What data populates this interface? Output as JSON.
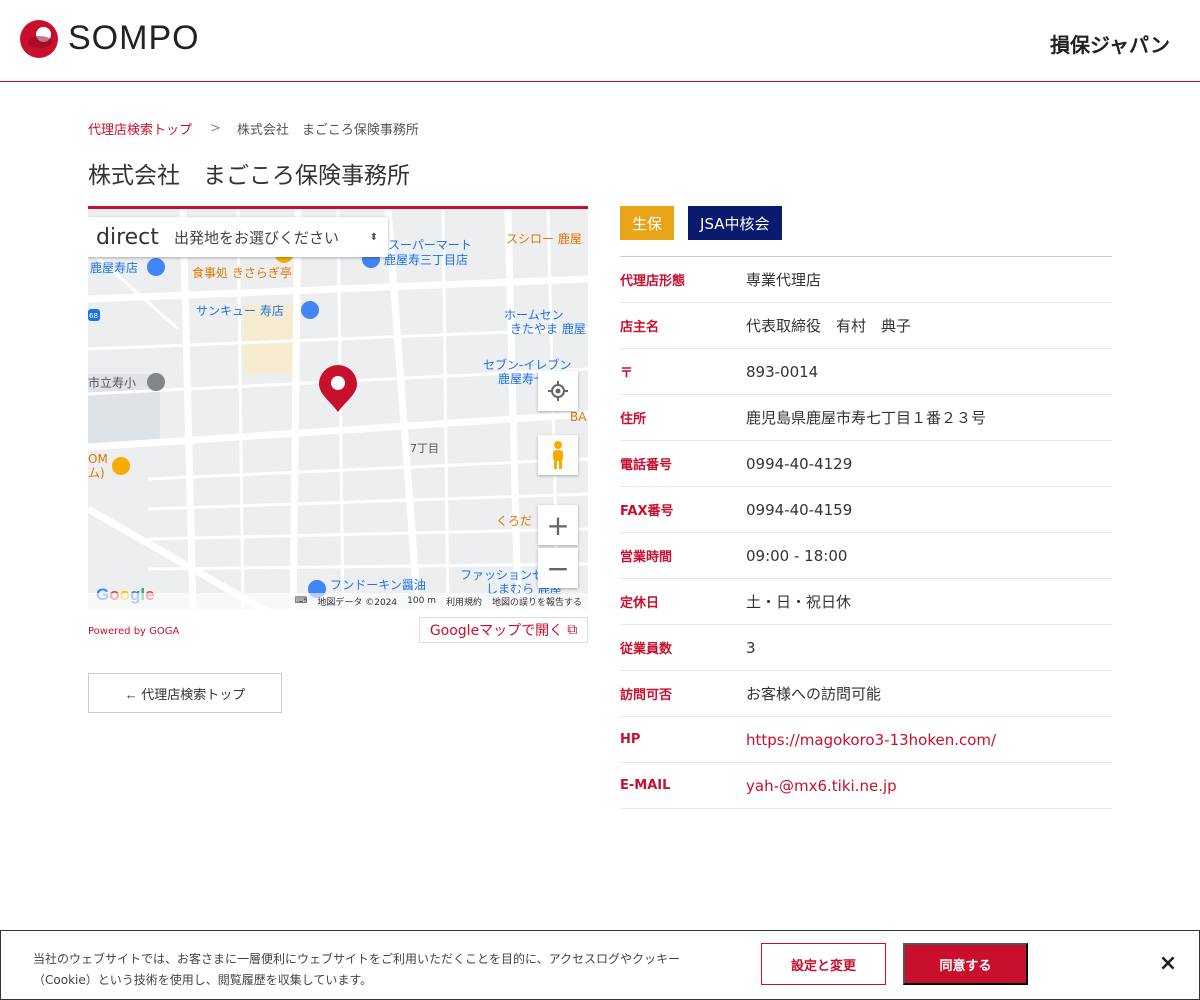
{
  "header": {
    "logo_text": "SOMPO",
    "brand_right": "損保ジャパン"
  },
  "breadcrumb": {
    "top_link": "代理店検索トップ",
    "separator": ">",
    "current": "株式会社　まごころ保険事務所"
  },
  "page_title": "株式会社　まごころ保険事務所",
  "map": {
    "direct_label": "direct",
    "select_placeholder": "出発地をお選びください",
    "places": [
      "シスーパーマート",
      "鹿屋寿三丁目店",
      "スシロー 鹿屋",
      "鹿屋寿店",
      "食事処 きさらぎ亭",
      "サンキュー 寿店",
      "ホームセン",
      "きたやま 鹿屋",
      "セブン-イレブン",
      "鹿屋寿七丁",
      "市立寿小",
      "BA",
      "7丁目",
      "OM",
      "ム)",
      "くろだ",
      "フンドーキン醤油",
      "ファッションセンタ",
      "しまむら 鹿屋"
    ],
    "route_number": "68",
    "google_logo": "Google",
    "map_data": "地図データ ©2024",
    "scale": "100 m",
    "terms": "利用規約",
    "report": "地図の誤りを報告する",
    "zoom_in": "+",
    "zoom_out": "−"
  },
  "powered_by": "Powered by GOGA",
  "google_maps_link": "Googleマップで開く",
  "back_button": "← 代理店検索トップ",
  "tags": [
    {
      "label": "生保",
      "color": "#e8a317"
    },
    {
      "label": "JSA中核会",
      "color": "#0a1a6e"
    }
  ],
  "info": {
    "type": {
      "label": "代理店形態",
      "value": "専業代理店"
    },
    "owner": {
      "label": "店主名",
      "value": "代表取締役　有村　典子"
    },
    "postal": {
      "label": "〒",
      "value": "893-0014"
    },
    "address": {
      "label": "住所",
      "value": "鹿児島県鹿屋市寿七丁目１番２３号"
    },
    "phone": {
      "label": "電話番号",
      "value": "0994-40-4129"
    },
    "fax": {
      "label": "FAX番号",
      "value": "0994-40-4159"
    },
    "hours": {
      "label": "営業時間",
      "value": "09:00 - 18:00"
    },
    "holiday": {
      "label": "定休日",
      "value": "土・日・祝日休"
    },
    "employees": {
      "label": "従業員数",
      "value": "3"
    },
    "visit": {
      "label": "訪問可否",
      "value": "お客様への訪問可能"
    },
    "hp": {
      "label": "HP",
      "value": "https://magokoro3-13hoken.com/"
    },
    "email": {
      "label": "E-MAIL",
      "value": "yah-@mx6.tiki.ne.jp"
    }
  },
  "cookie": {
    "text": "当社のウェブサイトでは、お客さまに一層便利にウェブサイトをご利用いただくことを目的に、アクセスログやクッキー（Cookie）という技術を使用し、閲覧履歴を収集しています。",
    "settings_button": "設定と変更",
    "agree_button": "同意する",
    "close": "×"
  },
  "colors": {
    "accent": "#c8102e"
  }
}
